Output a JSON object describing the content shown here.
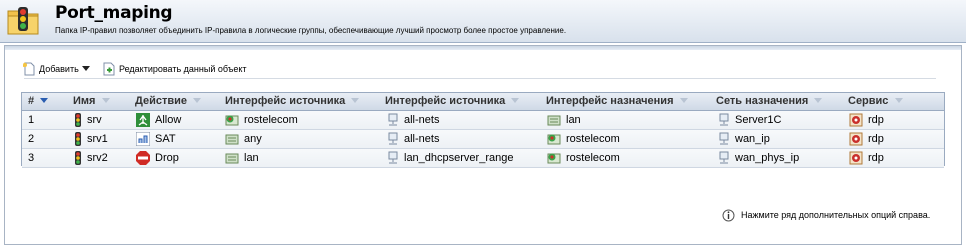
{
  "header": {
    "title": "Port_maping",
    "description": "Папка IP-правил позволяет объединить IP-правила в логические группы, обеспечивающие лучший просмотр более простое управление."
  },
  "toolbar": {
    "add_label": "Добавить",
    "edit_label": "Редактировать данный объект"
  },
  "table": {
    "columns": [
      "#",
      "Имя",
      "Действие",
      "Интерфейс источника",
      "Интерфейс источника",
      "Интерфейс назначения",
      "Сеть назначения",
      "Сервис"
    ],
    "rows": [
      {
        "num": "1",
        "name": "srv",
        "action": "Allow",
        "action_icon": "allow-icon",
        "src_if": "rostelecom",
        "src_if_icon": "interface-green-icon",
        "src_net": "all-nets",
        "src_net_icon": "network-object-icon",
        "dst_if": "lan",
        "dst_if_icon": "interface-lan-icon",
        "dst_net": "Server1C",
        "dst_net_icon": "network-object-icon",
        "service": "rdp",
        "service_icon": "service-icon"
      },
      {
        "num": "2",
        "name": "srv1",
        "action": "SAT",
        "action_icon": "sat-icon",
        "src_if": "any",
        "src_if_icon": "interface-lan-icon",
        "src_net": "all-nets",
        "src_net_icon": "network-object-icon",
        "dst_if": "rostelecom",
        "dst_if_icon": "interface-green-icon",
        "dst_net": "wan_ip",
        "dst_net_icon": "network-object-icon",
        "service": "rdp",
        "service_icon": "service-icon"
      },
      {
        "num": "3",
        "name": "srv2",
        "action": "Drop",
        "action_icon": "stop-icon",
        "src_if": "lan",
        "src_if_icon": "interface-lan-icon",
        "src_net": "lan_dhcpserver_range",
        "src_net_icon": "network-object-icon",
        "dst_if": "rostelecom",
        "dst_if_icon": "interface-green-icon",
        "dst_net": "wan_phys_ip",
        "dst_net_icon": "network-object-icon",
        "service": "rdp",
        "service_icon": "service-icon"
      }
    ]
  },
  "hint": {
    "text": "Нажмите ряд дополнительных опций справа."
  },
  "colors": {
    "header_gradient_top": "#f4f7fb",
    "header_gradient_bottom": "#d8e1ec",
    "grid_border": "#9aaac0",
    "sort_arrow": "#2a5db0"
  }
}
